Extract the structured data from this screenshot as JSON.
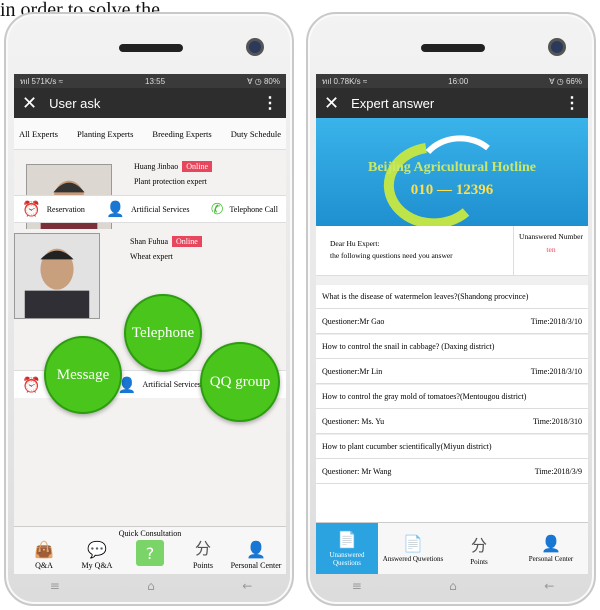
{
  "caption": "in order to solve the",
  "left": {
    "status": {
      "signal": "ทıl 571K/s ≈",
      "time": "13:55",
      "battery": "∀ ◷ 80%"
    },
    "title": "User ask",
    "tabs": [
      "All Experts",
      "Planting Experts",
      "Breeding Experts",
      "Duty Schedule"
    ],
    "experts": [
      {
        "name": "Huang Jinbao",
        "status": "Online",
        "title": "Plant protection expert"
      },
      {
        "name": "Shan Fuhua",
        "status": "Online",
        "title": "Wheat expert"
      }
    ],
    "actions": [
      "Reservation",
      "Artificial Services",
      "Telephone Call"
    ],
    "actions2": [
      "Artificial Services"
    ],
    "bubbles": {
      "telephone": "Telephone",
      "message": "Message",
      "qq": "QQ group"
    },
    "quick": "Quick Consultation",
    "nav": [
      "Q&A",
      "My Q&A",
      "Points",
      "Personal Center"
    ]
  },
  "right": {
    "status": {
      "signal": "ทıl 0.78K/s ≈",
      "time": "16:00",
      "battery": "∀ ◷ 66%"
    },
    "title": "Expert answer",
    "banner": {
      "line1": "Beijing Agricultural Hotline",
      "line2": "010 — 12396"
    },
    "greeting": "Dear Hu Expert:",
    "greeting2": "the following questions need you answer",
    "unanswered_label": "Unanswered Number",
    "unanswered_value": "ten",
    "questions": [
      {
        "q": "What is the disease of watermelon leaves?(Shandong procvince)",
        "who": "Questioner:Mr Gao",
        "time": "Time:2018/3/10"
      },
      {
        "q": "How to control the snail in cabbage? (Daxing district)",
        "who": "Questioner:Mr Lin",
        "time": "Time:2018/3/10"
      },
      {
        "q": "How to control the gray mold of tomatoes?(Mentougou district)",
        "who": "Questioner: Ms. Yu",
        "time": "Time:2018/310"
      },
      {
        "q": "How to plant cucumber scientifically(Miyun district)",
        "who": "Questioner: Mr Wang",
        "time": "Time:2018/3/9"
      }
    ],
    "nav": [
      "Unanswered Questions",
      "Answered Quwetions",
      "Points",
      "Personal Center"
    ]
  },
  "colors": {
    "accent": "#49c51b",
    "online": "#e8465c",
    "banner": "#2aa3e0",
    "active_tab": "#2aa3e0"
  }
}
